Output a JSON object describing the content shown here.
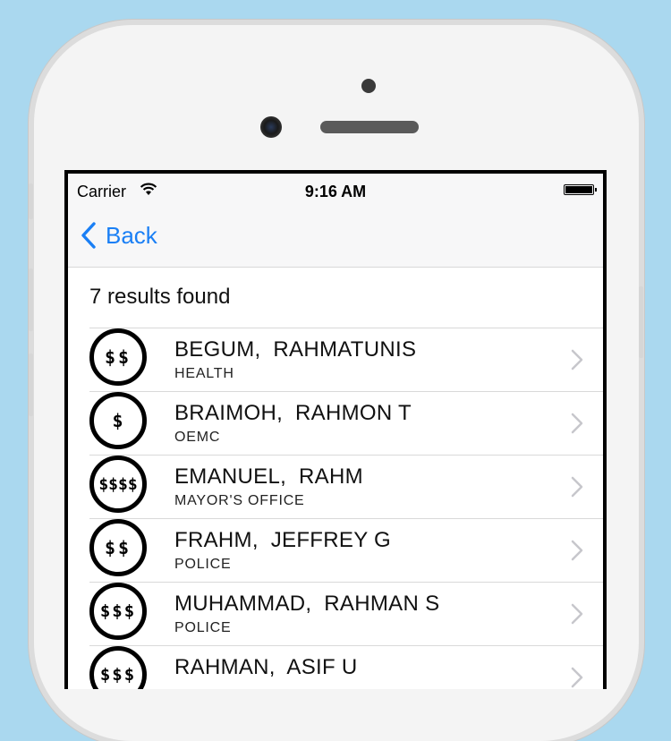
{
  "status_bar": {
    "carrier": "Carrier",
    "time": "9:16 AM"
  },
  "nav": {
    "back_label": "Back",
    "accent_color": "#1a7ff5"
  },
  "results_label": "7 results found",
  "rows": [
    {
      "badge": "$$",
      "name": "BEGUM,  RAHMATUNIS",
      "dept": "HEALTH"
    },
    {
      "badge": "$",
      "name": "BRAIMOH,  RAHMON T",
      "dept": "OEMC"
    },
    {
      "badge": "$$$$",
      "name": "EMANUEL,  RAHM",
      "dept": "MAYOR'S OFFICE"
    },
    {
      "badge": "$$",
      "name": "FRAHM,  JEFFREY G",
      "dept": "POLICE"
    },
    {
      "badge": "$$$",
      "name": "MUHAMMAD,  RAHMAN S",
      "dept": "POLICE"
    },
    {
      "badge": "$$$",
      "name": "RAHMAN,  ASIF U",
      "dept": ""
    }
  ]
}
